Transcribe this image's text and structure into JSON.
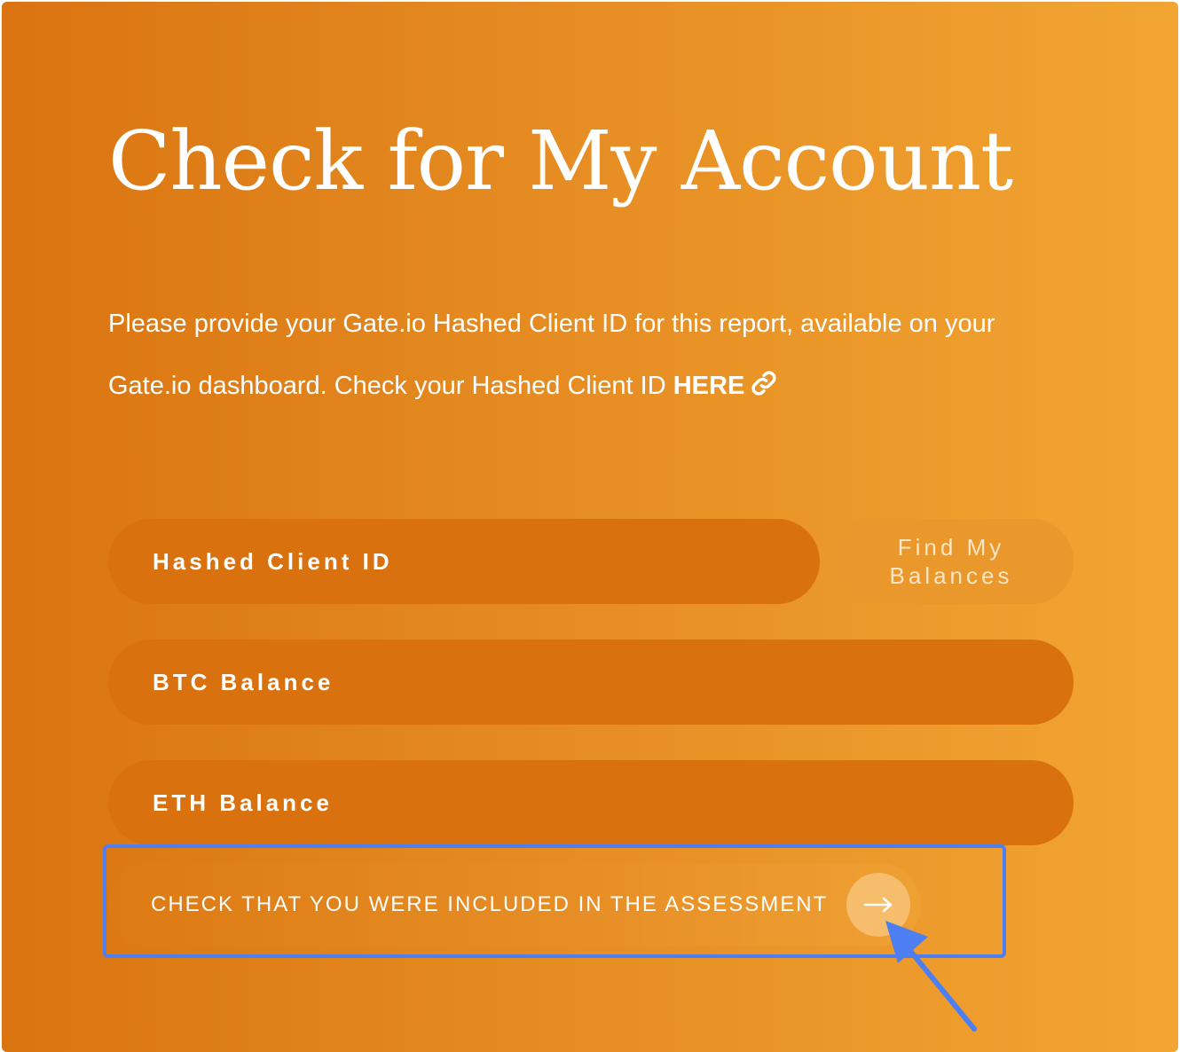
{
  "page": {
    "title": "Check for My Account",
    "description_line1": "Please provide your Gate.io Hashed Client ID for this report, available on your",
    "description_line2": "Gate.io dashboard. Check your Hashed Client ID ",
    "here_link": "HERE",
    "link_icon": "link-icon"
  },
  "form": {
    "hashed_client_id": {
      "placeholder": "Hashed Client ID",
      "value": ""
    },
    "find_button_label": "Find My Balances",
    "btc_balance": {
      "placeholder": "BTC Balance",
      "value": ""
    },
    "eth_balance": {
      "placeholder": "ETH Balance",
      "value": ""
    },
    "check_button_label": "CHECK THAT YOU WERE INCLUDED IN THE ASSESSMENT",
    "check_button_icon": "arrow-right-icon"
  },
  "annotation": {
    "highlight_color": "#4e7ff2"
  },
  "colors": {
    "gradient_start": "#da7410",
    "gradient_end": "#f2a532",
    "field_background": "#d9720e",
    "text": "#ffffff"
  }
}
